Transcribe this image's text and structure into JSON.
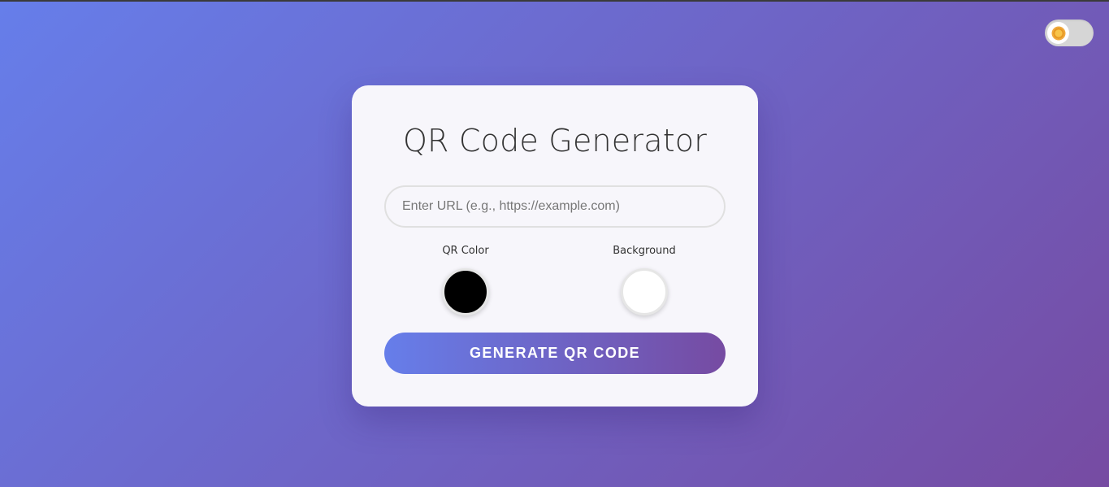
{
  "theme_toggle": {
    "icon": "sun-icon",
    "state": "light"
  },
  "card": {
    "title": "QR Code Generator",
    "url_input": {
      "value": "",
      "placeholder": "Enter URL (e.g., https://example.com)"
    },
    "qr_color": {
      "label": "QR Color",
      "value": "#000000"
    },
    "background_color": {
      "label": "Background",
      "value": "#ffffff"
    },
    "generate_button": "GENERATE QR CODE"
  },
  "colors": {
    "gradient_start": "#667eea",
    "gradient_end": "#764ba2",
    "card_background": "#f7f6fb"
  }
}
